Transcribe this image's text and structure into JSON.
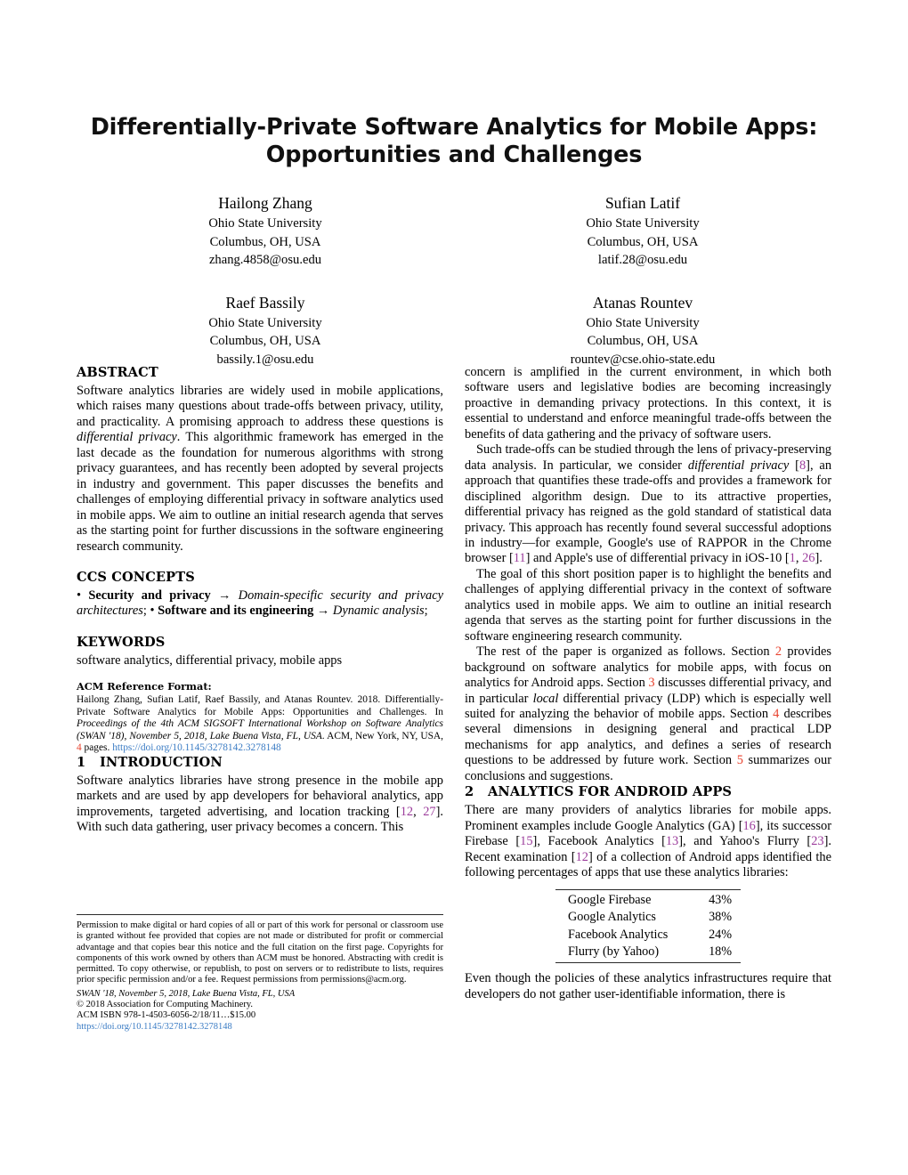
{
  "paper": {
    "title_line1": "Differentially-Private Software Analytics for Mobile Apps:",
    "title_line2": "Opportunities and Challenges"
  },
  "authors": [
    {
      "name": "Hailong Zhang",
      "affiliation": "Ohio State University",
      "location": "Columbus, OH, USA",
      "email": "zhang.4858@osu.edu"
    },
    {
      "name": "Sufian Latif",
      "affiliation": "Ohio State University",
      "location": "Columbus, OH, USA",
      "email": "latif.28@osu.edu"
    },
    {
      "name": "Raef Bassily",
      "affiliation": "Ohio State University",
      "location": "Columbus, OH, USA",
      "email": "bassily.1@osu.edu"
    },
    {
      "name": "Atanas Rountev",
      "affiliation": "Ohio State University",
      "location": "Columbus, OH, USA",
      "email": "rountev@cse.ohio-state.edu"
    }
  ],
  "abstract": {
    "heading": "ABSTRACT",
    "part1": "Software analytics libraries are widely used in mobile applications, which raises many questions about trade-offs between privacy, utility, and practicality. A promising approach to address these questions is ",
    "emph1": "differential privacy",
    "part2": ". This algorithmic framework has emerged in the last decade as the foundation for numerous algorithms with strong privacy guarantees, and has recently been adopted by several projects in industry and government. This paper discusses the benefits and challenges of employing differential privacy in software analytics used in mobile apps. We aim to outline an initial research agenda that serves as the starting point for further discussions in the software engineering research community."
  },
  "ccs": {
    "heading": "CCS CONCEPTS",
    "bullet": "• ",
    "term1": "Security and privacy",
    "arrow1": " → ",
    "desc1": "Domain-specific security and privacy architectures",
    "sep": "; • ",
    "term2": "Software and its engineering",
    "arrow2": " → ",
    "desc2": "Dynamic analysis",
    "end": ";"
  },
  "keywords": {
    "heading": "KEYWORDS",
    "text": "software analytics, differential privacy, mobile apps"
  },
  "reference_format": {
    "heading": "ACM Reference Format:",
    "part1": "Hailong Zhang, Sufian Latif, Raef Bassily, and Atanas Rountev. 2018. Differentially-Private Software Analytics for Mobile Apps: Opportunities and Challenges. In ",
    "venue_italic": "Proceedings of the 4th ACM SIGSOFT International Workshop on Software Analytics (SWAN '18), November 5, 2018, Lake Buena Vista, FL, USA",
    "part2": ". ACM, New York, NY, USA, ",
    "pages": "4",
    "part3": " pages. ",
    "doi": "https://doi.org/10.1145/3278142.3278148"
  },
  "introduction": {
    "number": "1",
    "heading": "INTRODUCTION",
    "part1": "Software analytics libraries have strong presence in the mobile app markets and are used by app developers for behavioral analytics, app improvements, targeted advertising, and location tracking [",
    "cite1": "12",
    "citesep": ", ",
    "cite2": "27",
    "part2": "]. With such data gathering, user privacy becomes a concern. This"
  },
  "footnote": {
    "permission": "Permission to make digital or hard copies of all or part of this work for personal or classroom use is granted without fee provided that copies are not made or distributed for profit or commercial advantage and that copies bear this notice and the full citation on the first page. Copyrights for components of this work owned by others than ACM must be honored. Abstracting with credit is permitted. To copy otherwise, or republish, to post on servers or to redistribute to lists, requires prior specific permission and/or a fee. Request permissions from permissions@acm.org.",
    "venue": "SWAN '18, November 5, 2018, Lake Buena Vista, FL, USA",
    "copyright": "© 2018 Association for Computing Machinery.",
    "isbn": "ACM ISBN 978-1-4503-6056-2/18/11…$15.00",
    "doi": "https://doi.org/10.1145/3278142.3278148"
  },
  "right_column": {
    "para1": "concern is amplified in the current environment, in which both software users and legislative bodies are becoming increasingly proactive in demanding privacy protections. In this context, it is essential to understand and enforce meaningful trade-offs between the benefits of data gathering and the privacy of software users.",
    "para2_a": "Such trade-offs can be studied through the lens of privacy-preserving data analysis. In particular, we consider ",
    "para2_emph": "differential privacy",
    "para2_b": " [",
    "para2_cite1": "8",
    "para2_c": "], an approach that quantifies these trade-offs and provides a framework for disciplined algorithm design. Due to its attractive properties, differential privacy has reigned as the gold standard of statistical data privacy. This approach has recently found several successful adoptions in industry—for example, Google's use of RAPPOR in the Chrome browser [",
    "para2_cite2": "11",
    "para2_d": "] and Apple's use of differential privacy in iOS-10 [",
    "para2_cite3": "1",
    "para2_sep": ", ",
    "para2_cite4": "26",
    "para2_e": "].",
    "para3": "The goal of this short position paper is to highlight the benefits and challenges of applying differential privacy in the context of software analytics used in mobile apps. We aim to outline an initial research agenda that serves as the starting point for further discussions in the software engineering research community.",
    "para4_a": "The rest of the paper is organized as follows. Section ",
    "para4_sec2": "2",
    "para4_b": " provides background on software analytics for mobile apps, with focus on analytics for Android apps. Section ",
    "para4_sec3": "3",
    "para4_c": " discusses differential privacy, and in particular ",
    "para4_emph": "local",
    "para4_d": " differential privacy (LDP) which is especially well suited for analyzing the behavior of mobile apps. Section ",
    "para4_sec4": "4",
    "para4_e": " describes several dimensions in designing general and practical LDP mechanisms for app analytics, and defines a series of research questions to be addressed by future work. Section ",
    "para4_sec5": "5",
    "para4_f": " summarizes our conclusions and suggestions."
  },
  "section2": {
    "number": "2",
    "heading": "ANALYTICS FOR ANDROID APPS",
    "para_a": "There are many providers of analytics libraries for mobile apps. Prominent examples include Google Analytics (GA) [",
    "cite_ga": "16",
    "para_b": "], its successor Firebase [",
    "cite_fb": "15",
    "para_c": "], Facebook Analytics [",
    "cite_fa": "13",
    "para_d": "], and Yahoo's Flurry [",
    "cite_fl": "23",
    "para_e": "]. Recent examination [",
    "cite_re": "12",
    "para_f": "] of a collection of Android apps identified the following percentages of apps that use these analytics libraries:",
    "table": {
      "rows": [
        {
          "library": "Google Firebase",
          "percentage": "43%"
        },
        {
          "library": "Google Analytics",
          "percentage": "38%"
        },
        {
          "library": "Facebook Analytics",
          "percentage": "24%"
        },
        {
          "library": "Flurry (by Yahoo)",
          "percentage": "18%"
        }
      ]
    },
    "para_after": "Even though the policies of these analytics infrastructures require that developers do not gather user-identifiable information, there is"
  },
  "colors": {
    "citation": "#9c3d9c",
    "section_ref": "#e8422e",
    "link": "#3b7cc4"
  }
}
